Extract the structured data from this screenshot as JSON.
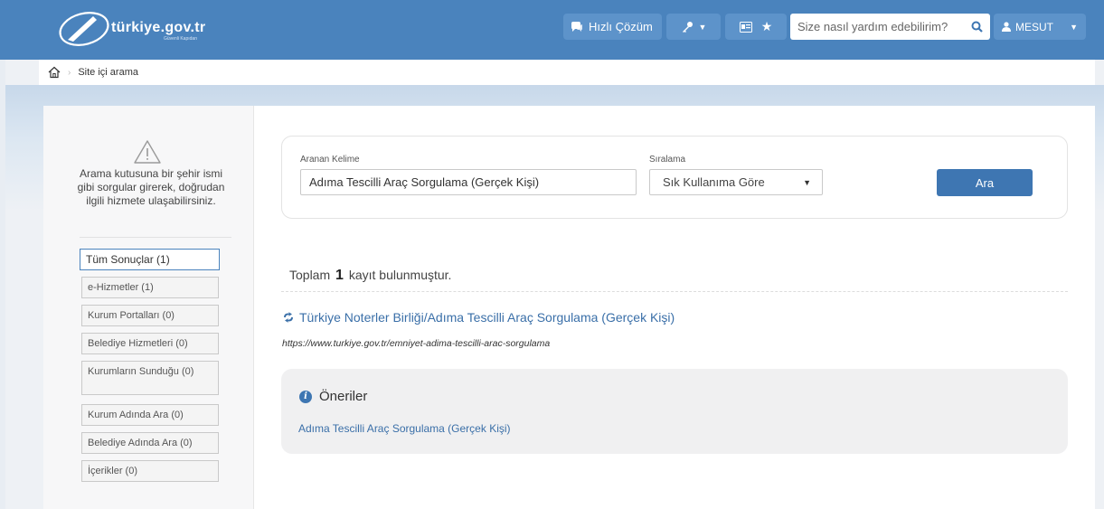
{
  "header": {
    "logo_text": "türkiye.gov.tr",
    "logo_sub": "Güvenli Kapıdan",
    "quick_solution": "Hızlı Çözüm",
    "search_placeholder": "Size nasıl yardım edebilirim?",
    "user": "MESUT",
    "icons": [
      "chat-icon",
      "key-icon",
      "id-card-icon",
      "star-icon",
      "search-icon",
      "user-icon"
    ]
  },
  "breadcrumb": {
    "current": "Site içi arama"
  },
  "sidebar": {
    "hint": "Arama kutusuna bir şehir ismi gibi sorgular girerek, doğrudan ilgili hizmete ulaşabilirsiniz.",
    "filters": [
      {
        "label": "Tüm Sonuçlar (1)"
      },
      {
        "label": "e-Hizmetler (1)"
      },
      {
        "label": "Kurum Portalları (0)"
      },
      {
        "label": "Belediye Hizmetleri (0)"
      },
      {
        "label": "Kurumların Sunduğu (0)"
      },
      {
        "label": "Kurum Adında Ara (0)"
      },
      {
        "label": "Belediye Adında Ara (0)"
      },
      {
        "label": "İçerikler (0)"
      }
    ]
  },
  "search": {
    "keyword_label": "Aranan Kelime",
    "keyword_value": "Adıma Tescilli Araç Sorgulama (Gerçek Kişi)",
    "sort_label": "Sıralama",
    "sort_value": "Sık Kullanıma Göre",
    "button": "Ara"
  },
  "results": {
    "total_prefix": "Toplam",
    "total_count": "1",
    "total_suffix": "kayıt bulunmuştur.",
    "items": [
      {
        "title": "Türkiye Noterler Birliği/Adıma Tescilli Araç Sorgulama (Gerçek Kişi)",
        "url": "https://www.turkiye.gov.tr/emniyet-adima-tescilli-arac-sorgulama"
      }
    ]
  },
  "suggestions": {
    "title": "Öneriler",
    "items": [
      "Adıma Tescilli Araç Sorgulama (Gerçek Kişi)"
    ]
  },
  "colors": {
    "header": "#4a83bd",
    "accent": "#3e76b2",
    "link": "#3a6fa8"
  }
}
